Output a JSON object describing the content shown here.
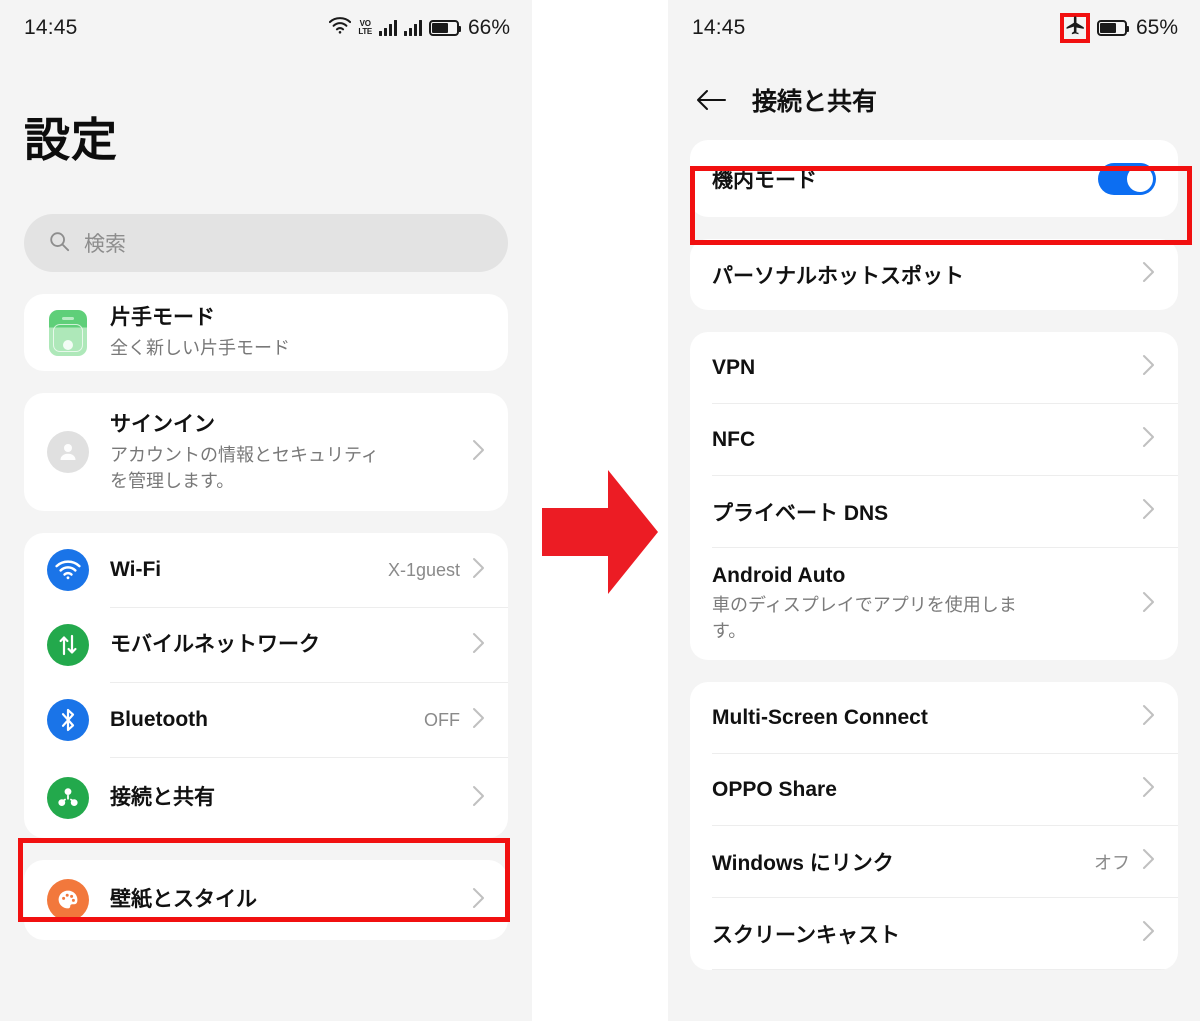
{
  "left_phone": {
    "statusbar": {
      "time": "14:45",
      "battery_percent": "66%",
      "icons": [
        "wifi-icon",
        "volte-icon",
        "signal-bars-icon",
        "signal-bars-icon",
        "battery-icon"
      ],
      "volte_top": "VO",
      "volte_bottom": "LTE"
    },
    "page_title": "設定",
    "search": {
      "placeholder": "検索",
      "icon": "search-icon"
    },
    "groups": [
      {
        "items": [
          {
            "title": "片手モード",
            "sub": "全く新しい片手モード",
            "icon": "one-handed-mode-icon",
            "value": "",
            "chevron": false
          }
        ]
      },
      {
        "items": [
          {
            "title": "サインイン",
            "sub": "アカウントの情報とセキュリティ\nを管理します。",
            "icon": "account-avatar-icon",
            "value": "",
            "chevron": true
          }
        ]
      },
      {
        "items": [
          {
            "title": "Wi-Fi",
            "sub": "",
            "icon": "wifi-icon",
            "value": "X-1guest",
            "chevron": true
          },
          {
            "title": "モバイルネットワーク",
            "sub": "",
            "icon": "mobile-network-icon",
            "value": "",
            "chevron": true
          },
          {
            "title": "Bluetooth",
            "sub": "",
            "icon": "bluetooth-icon",
            "value": "OFF",
            "chevron": true
          },
          {
            "title": "接続と共有",
            "sub": "",
            "icon": "connection-sharing-icon",
            "value": "",
            "chevron": true
          }
        ]
      },
      {
        "items": [
          {
            "title": "壁紙とスタイル",
            "sub": "",
            "icon": "wallpaper-style-icon",
            "value": "",
            "chevron": true
          }
        ]
      }
    ]
  },
  "right_phone": {
    "statusbar": {
      "time": "14:45",
      "battery_percent": "65%",
      "icons": [
        "airplane-mode-icon",
        "battery-icon"
      ]
    },
    "appbar": {
      "back_icon": "back-arrow-icon",
      "title": "接続と共有"
    },
    "groups": [
      {
        "items": [
          {
            "title": "機内モード",
            "sub": "",
            "value": "",
            "control": "toggle",
            "toggle_on": true,
            "chevron": false
          }
        ]
      },
      {
        "items": [
          {
            "title": "パーソナルホットスポット",
            "sub": "",
            "value": "",
            "control": "chevron",
            "chevron": true
          }
        ]
      },
      {
        "items": [
          {
            "title": "VPN",
            "sub": "",
            "value": "",
            "control": "chevron",
            "chevron": true
          },
          {
            "title": "NFC",
            "sub": "",
            "value": "",
            "control": "chevron",
            "chevron": true
          },
          {
            "title": "プライベート DNS",
            "sub": "",
            "value": "",
            "control": "chevron",
            "chevron": true
          },
          {
            "title": "Android Auto",
            "sub": "車のディスプレイでアプリを使用しま\nす。",
            "value": "",
            "control": "chevron",
            "chevron": true
          }
        ]
      },
      {
        "items": [
          {
            "title": "Multi-Screen Connect",
            "sub": "",
            "value": "",
            "control": "chevron",
            "chevron": true
          },
          {
            "title": "OPPO Share",
            "sub": "",
            "value": "",
            "control": "chevron",
            "chevron": true
          },
          {
            "title": "Windows にリンク",
            "sub": "",
            "value": "オフ",
            "control": "chevron",
            "chevron": true
          },
          {
            "title": "スクリーンキャスト",
            "sub": "",
            "value": "",
            "control": "chevron",
            "chevron": true
          }
        ]
      }
    ]
  },
  "annotations": {
    "arrow_icon": "right-arrow-annotation",
    "highlight_color": "#f11010",
    "boxes": [
      "connect-share-row",
      "airplane-mode-row",
      "airplane-status-icon"
    ]
  },
  "colors": {
    "accent_blue": "#1a74e8",
    "toggle_on": "#0c6ef2",
    "green": "#23a94c",
    "orange": "#f2783c",
    "annotation_red": "#f11010",
    "arrow_red": "#ec1c24",
    "panel_bg": "#f4f4f4",
    "card_bg": "#ffffff"
  }
}
